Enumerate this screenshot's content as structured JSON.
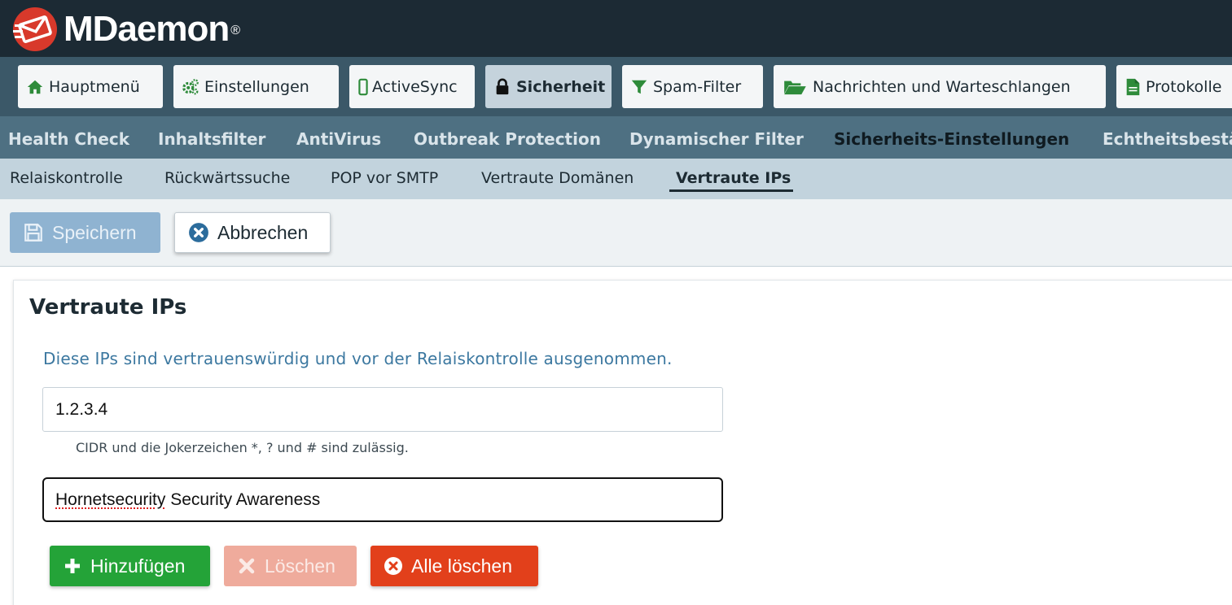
{
  "app": {
    "brand_name": "MDaemon",
    "brand_mark": "®"
  },
  "main_nav": {
    "items": [
      {
        "label": "Hauptmenü",
        "icon": "home-icon"
      },
      {
        "label": "Einstellungen",
        "icon": "gears-icon"
      },
      {
        "label": "ActiveSync",
        "icon": "mobile-icon"
      },
      {
        "label": "Sicherheit",
        "icon": "lock-icon",
        "active": true
      },
      {
        "label": "Spam-Filter",
        "icon": "filter-icon"
      },
      {
        "label": "Nachrichten und Warteschlangen",
        "icon": "folder-open-icon"
      },
      {
        "label": "Protokolle",
        "icon": "file-icon"
      }
    ]
  },
  "sub_nav": {
    "items": [
      {
        "label": "Health Check"
      },
      {
        "label": "Inhaltsfilter"
      },
      {
        "label": "AntiVirus"
      },
      {
        "label": "Outbreak Protection"
      },
      {
        "label": "Dynamischer Filter"
      },
      {
        "label": "Sicherheits-Einstellungen",
        "active": true
      },
      {
        "label": "Echtheitsbestätigung"
      }
    ]
  },
  "section_nav": {
    "items": [
      {
        "label": "Relaiskontrolle"
      },
      {
        "label": "Rückwärtssuche"
      },
      {
        "label": "POP vor SMTP"
      },
      {
        "label": "Vertraute Domänen"
      },
      {
        "label": "Vertraute IPs",
        "active": true
      }
    ]
  },
  "toolbar": {
    "save_label": "Speichern",
    "cancel_label": "Abbrechen"
  },
  "panel": {
    "title": "Vertraute IPs",
    "description": "Diese IPs sind vertrauenswürdig und vor der Relaiskontrolle ausgenommen.",
    "ip_value": "1.2.3.4",
    "hint": "CIDR und die Jokerzeichen *, ? und # sind zulässig.",
    "comment_value_misspelled": "Hornetsecurity",
    "comment_value_rest": " Security Awareness",
    "add_label": "Hinzufügen",
    "delete_label": "Löschen",
    "delete_all_label": "Alle löschen"
  },
  "colors": {
    "header_bg": "#1c2a34",
    "nav_bg": "#3b5868",
    "subnav_bg": "#4e7082",
    "section_nav_bg": "#c2d3dd",
    "accent_text": "#3c78a0",
    "add_green": "#24a338",
    "delete_red": "#e2401b",
    "logo_red": "#d8392b"
  }
}
